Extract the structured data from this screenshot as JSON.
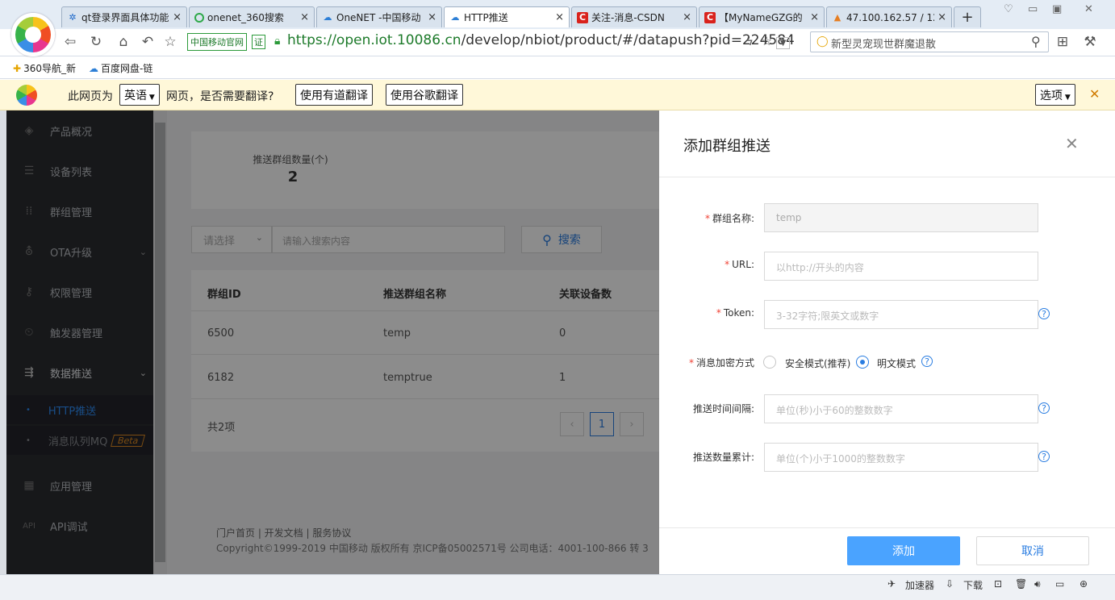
{
  "browser": {
    "tabs": [
      {
        "title": "qt登录界面具体功能",
        "icon": "gear-icon"
      },
      {
        "title": "onenet_360搜索",
        "icon": "360-search-icon"
      },
      {
        "title": "OneNET -中国移动",
        "icon": "cloud-icon"
      },
      {
        "title": "HTTP推送",
        "icon": "cloud-icon",
        "active": true
      },
      {
        "title": "关注-消息-CSDN",
        "icon": "csdn-icon"
      },
      {
        "title": "【MyNameGZG的",
        "icon": "csdn-icon"
      },
      {
        "title": "47.100.162.57 / 12",
        "icon": "phpmyadmin-icon"
      }
    ],
    "cmcc_badge": "中国移动官网",
    "cert_badge": "证",
    "url_host": "https://open.iot.10086.cn",
    "url_path": "/develop/nbiot/product/#/datapush?pid=224584",
    "search_text": "新型灵宠现世群魔退散",
    "bookmarks": [
      "360导航_新",
      "百度网盘-链"
    ]
  },
  "translate_bar": {
    "prefix": "此网页为",
    "language": "英语",
    "suffix": "网页，是否需要翻译?",
    "youdao": "使用有道翻译",
    "google": "使用谷歌翻译",
    "options": "选项"
  },
  "sidebar": {
    "items": [
      "产品概况",
      "设备列表",
      "群组管理",
      "OTA升级",
      "权限管理",
      "触发器管理",
      "数据推送",
      "应用管理",
      "API调试"
    ],
    "sub_items": [
      "HTTP推送",
      "消息队列MQ"
    ],
    "beta": "Beta"
  },
  "main": {
    "stat_label": "推送群组数量(个)",
    "stat_value": "2",
    "select_placeholder": "请选择",
    "search_placeholder": "请输入搜索内容",
    "search_button": "搜索",
    "columns": [
      "群组ID",
      "推送群组名称",
      "关联设备数"
    ],
    "rows": [
      [
        "6500",
        "temp",
        "0"
      ],
      [
        "6182",
        "temptrue",
        "1"
      ]
    ],
    "total": "共2项",
    "page": "1",
    "footer_links": "门户首页 | 开发文档 | 服务协议",
    "footer_copy": "Copyright©1999-2019 中国移动 版权所有 京ICP备05002571号 公司电话：4001-100-866 转 3"
  },
  "drawer": {
    "title": "添加群组推送",
    "fields": {
      "name_label": "群组名称:",
      "name_value": "temp",
      "url_label": "URL:",
      "url_placeholder": "以http://开头的内容",
      "token_label": "Token:",
      "token_placeholder": "3-32字符;限英文或数字",
      "encrypt_label": "消息加密方式",
      "encrypt_safe": "安全模式(推荐)",
      "encrypt_plain": "明文模式",
      "interval_label": "推送时间间隔:",
      "interval_placeholder": "单位(秒)小于60的整数数字",
      "count_label": "推送数量累计:",
      "count_placeholder": "单位(个)小于1000的整数数字"
    },
    "add_button": "添加",
    "cancel_button": "取消"
  },
  "statusbar": {
    "accelerator": "加速器",
    "download": "下载"
  },
  "colors": {
    "accent": "#2a7de1",
    "add_button": "#4aa3ff",
    "sidebar": "#2b2c30",
    "url_green": "#1d7a2a"
  }
}
